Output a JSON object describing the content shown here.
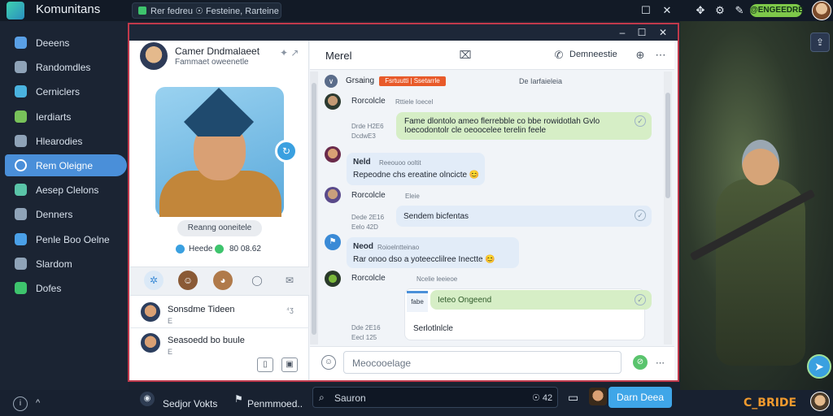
{
  "topbar": {
    "app_title": "Komunitans",
    "tab_label": "Rer fedreu ☉ Festeine, Rarteine",
    "badge": "@ENGEEDRE",
    "window_controls": [
      "–",
      "☐",
      "✕"
    ]
  },
  "sidebar": {
    "items": [
      {
        "label": "Deeens",
        "icon": "people-icon",
        "color": "#5aa0e6"
      },
      {
        "label": "Randomdles",
        "icon": "grid-icon",
        "color": "#8fa3b8"
      },
      {
        "label": "Cerniclers",
        "icon": "chat-icon",
        "color": "#4ab3e0"
      },
      {
        "label": "Ierdiarts",
        "icon": "map-icon",
        "color": "#78c25a"
      },
      {
        "label": "Hlearodies",
        "icon": "clock-icon",
        "color": "#8fa3b8"
      },
      {
        "label": "Rem Oleigne",
        "icon": "circle-icon",
        "color": "#ffffff",
        "active": true
      },
      {
        "label": "Aesep Clelons",
        "icon": "gear-icon",
        "color": "#5ac4a8"
      },
      {
        "label": "Denners",
        "icon": "list-icon",
        "color": "#8fa3b8"
      },
      {
        "label": "Penle Boo Oelne",
        "icon": "heart-icon",
        "color": "#4aa0e8"
      },
      {
        "label": "Slardom",
        "icon": "star-icon",
        "color": "#8fa3b8"
      },
      {
        "label": "Dofes",
        "icon": "shield-icon",
        "color": "#3ec46d"
      }
    ]
  },
  "profile": {
    "name": "Camer Dndmalaeet",
    "subtitle": "Fammaet oweenetle",
    "pill": "Reanng ooneitele",
    "stat1": "Heede",
    "stat2": "80 08.62",
    "contacts": [
      {
        "name": "Sonsdme Tideen",
        "meta": "E",
        "time": "⁴ʒ"
      },
      {
        "name": "Seasoedd bo buule",
        "meta": "E",
        "time": ""
      }
    ]
  },
  "chat": {
    "title": "Merel",
    "header_action": "Demneestie",
    "channel_name": "Grsaing",
    "channel_tag": "Fsrtuutti | Ssetarrle",
    "channel_meta": "De Iarfaieleia",
    "messages": [
      {
        "sender": "Rorcolcle",
        "time": "Rttiele Ioecel"
      },
      {
        "meta": "Drde H2E6\nDcdwE3",
        "text": "Fame dlontolo ameo flerrebble co bbe rowidotlah Gvlo\nIoecodontolr cle oeoocelee terelin feele"
      },
      {
        "sender": "Neld",
        "time": "Reeouoo ooltit",
        "text": "Repeodne chs ereatine olncicte 😊"
      },
      {
        "sender": "Rorcolcle",
        "time": "Eleie"
      },
      {
        "meta": "Dede 2E16\nEelo 42D",
        "text": "Sendem bicfentas"
      },
      {
        "sender": "Neod",
        "time": "Roioelntteinao",
        "text": "Rar onoo dso a yoteecclilree Inectte 😊"
      },
      {
        "sender": "Rorcolcle",
        "time": "Ncelie leeieoe"
      },
      {
        "card_tag": "fabe",
        "card_text": "Ieteo Ongeend",
        "meta": "Dde 2E16\nEecl 125",
        "text": "Serlotlnlcle"
      }
    ],
    "input_placeholder": "Meocooelage"
  },
  "bottombar": {
    "item1": "Sedjor Vokts",
    "item2": "Penmmoed..",
    "search_placeholder": "Sauron",
    "search_meta": "☉ 42",
    "send_label": "Darn Deea",
    "brand": "C_BRIDE"
  }
}
